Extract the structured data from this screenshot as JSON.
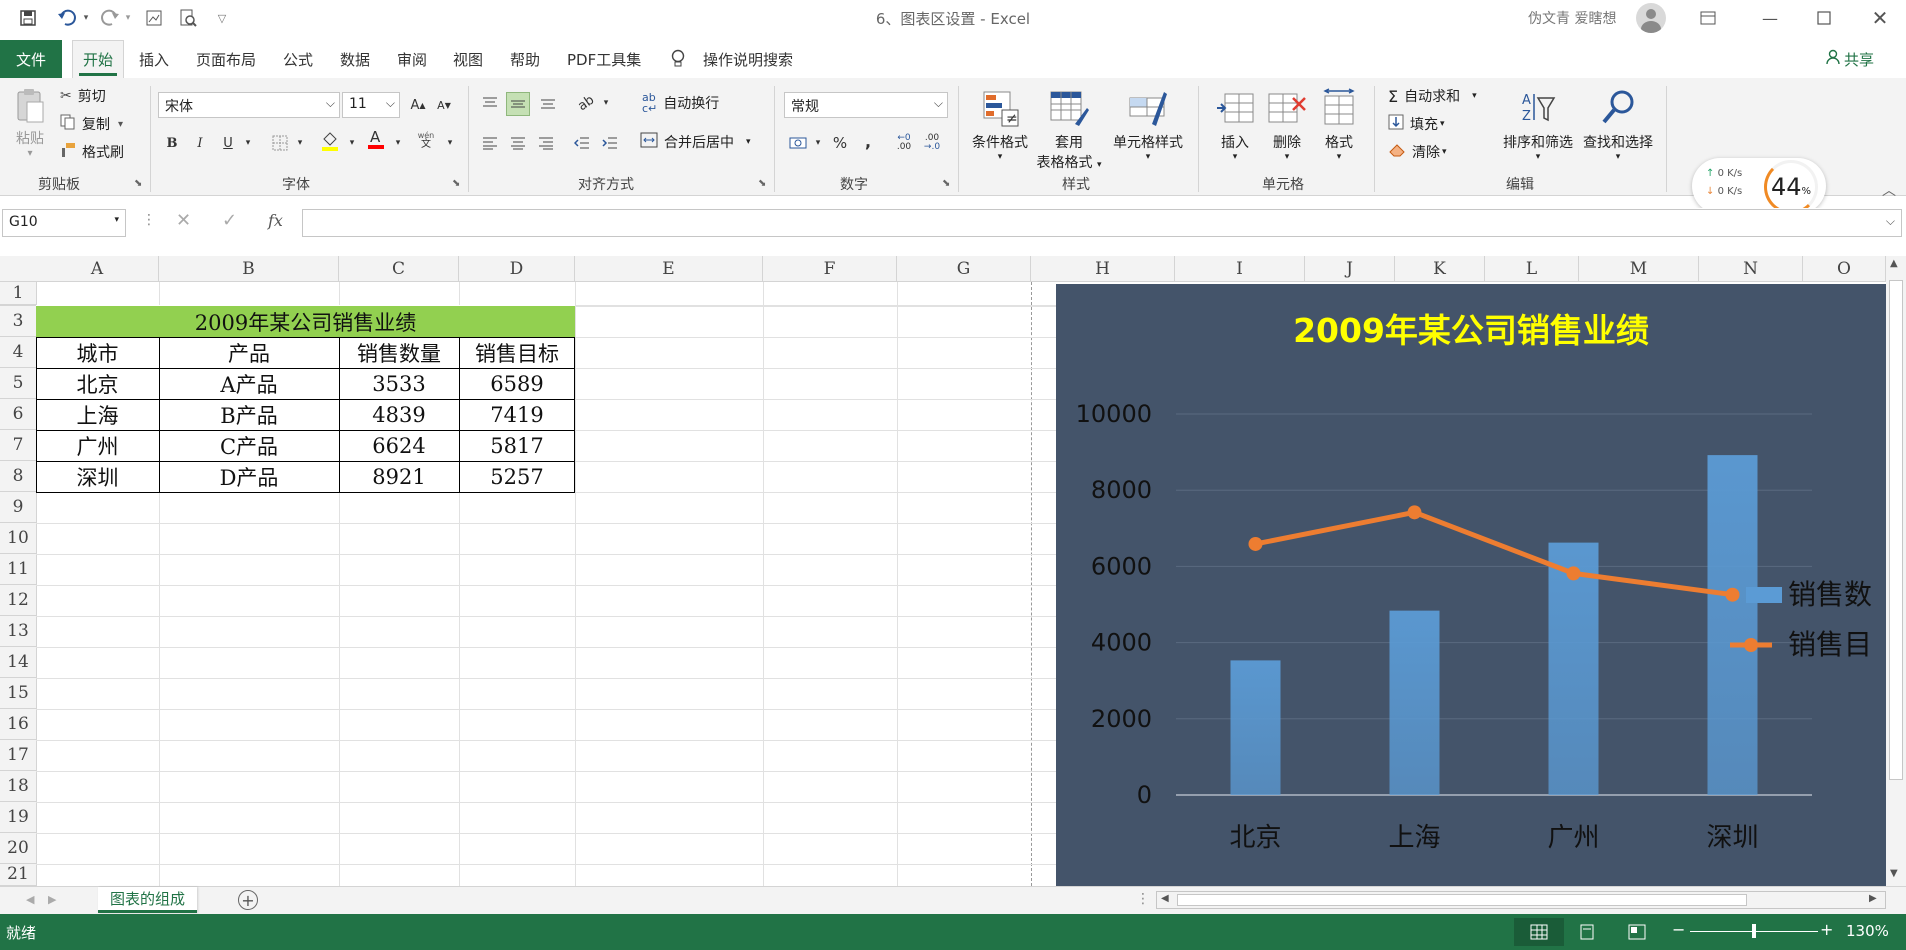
{
  "window": {
    "title": "6、图表区设置 - Excel",
    "user": "伪文青 爱瞎想"
  },
  "quick_access": {
    "save": "save-icon",
    "undo": "undo-icon",
    "redo": "redo-icon"
  },
  "tabs": [
    {
      "label": "文件"
    },
    {
      "label": "开始"
    },
    {
      "label": "插入"
    },
    {
      "label": "页面布局"
    },
    {
      "label": "公式"
    },
    {
      "label": "数据"
    },
    {
      "label": "审阅"
    },
    {
      "label": "视图"
    },
    {
      "label": "帮助"
    },
    {
      "label": "PDF工具集"
    },
    {
      "label": "操作说明搜索"
    }
  ],
  "share": "共享",
  "ribbon": {
    "clipboard": {
      "paste": "粘贴",
      "cut": "剪切",
      "copy": "复制",
      "format_painter": "格式刷",
      "label": "剪贴板"
    },
    "font": {
      "name": "宋体",
      "size": "11",
      "bold": "B",
      "italic": "I",
      "underline": "U",
      "label": "字体",
      "phonetic": "文"
    },
    "alignment": {
      "wrap": "自动换行",
      "merge": "合并后居中",
      "label": "对齐方式"
    },
    "number": {
      "format": "常规",
      "label": "数字",
      "percent": "%",
      "comma": ","
    },
    "styles": {
      "conditional": "条件格式",
      "table_format_1": "套用",
      "table_format_2": "表格格式",
      "cell_styles": "单元格样式",
      "label": "样式"
    },
    "cells": {
      "insert": "插入",
      "delete": "删除",
      "format": "格式",
      "label": "单元格"
    },
    "editing": {
      "autosum": "自动求和",
      "fill": "填充",
      "clear": "清除",
      "sort_filter": "排序和筛选",
      "find_select": "查找和选择",
      "label": "编辑"
    }
  },
  "net_widget": {
    "up": "0 K/s",
    "down": "0 K/s",
    "percent": "44",
    "percent_sign": "%"
  },
  "formula_bar": {
    "name_box": "G10",
    "fx": "fx",
    "value": ""
  },
  "columns": [
    "A",
    "B",
    "C",
    "D",
    "E",
    "F",
    "G",
    "H",
    "I",
    "J",
    "K",
    "L",
    "M",
    "N",
    "O"
  ],
  "rows": [
    "1",
    "2",
    "3",
    "4",
    "5",
    "6",
    "7",
    "8",
    "9",
    "10",
    "11",
    "12",
    "13",
    "14",
    "15",
    "16",
    "17",
    "18",
    "19",
    "20",
    "21"
  ],
  "table": {
    "title": "2009年某公司销售业绩",
    "title_bg": "#92d050",
    "headers": [
      "城市",
      "产品",
      "销售数量",
      "销售目标"
    ],
    "rows": [
      [
        "北京",
        "A产品",
        "3533",
        "6589"
      ],
      [
        "上海",
        "B产品",
        "4839",
        "7419"
      ],
      [
        "广州",
        "C产品",
        "6624",
        "5817"
      ],
      [
        "深圳",
        "D产品",
        "8921",
        "5257"
      ]
    ]
  },
  "chart_data": {
    "type": "bar",
    "title": "2009年某公司销售业绩",
    "title_color": "#ffff00",
    "background": "#44546a",
    "categories": [
      "北京",
      "上海",
      "广州",
      "深圳"
    ],
    "series": [
      {
        "name": "销售数",
        "type": "bar",
        "values": [
          3533,
          4839,
          6624,
          8921
        ],
        "color": "#5b9bd5"
      },
      {
        "name": "销售目",
        "type": "line",
        "values": [
          6589,
          7419,
          5817,
          5257
        ],
        "color": "#ed7d31"
      }
    ],
    "yticks": [
      "0",
      "2000",
      "4000",
      "6000",
      "8000",
      "10000"
    ],
    "ylim": [
      0,
      10000
    ],
    "grid": true,
    "legend": "right"
  },
  "sheet_tab": "图表的组成",
  "status": {
    "ready": "就绪",
    "zoom": "130%"
  }
}
